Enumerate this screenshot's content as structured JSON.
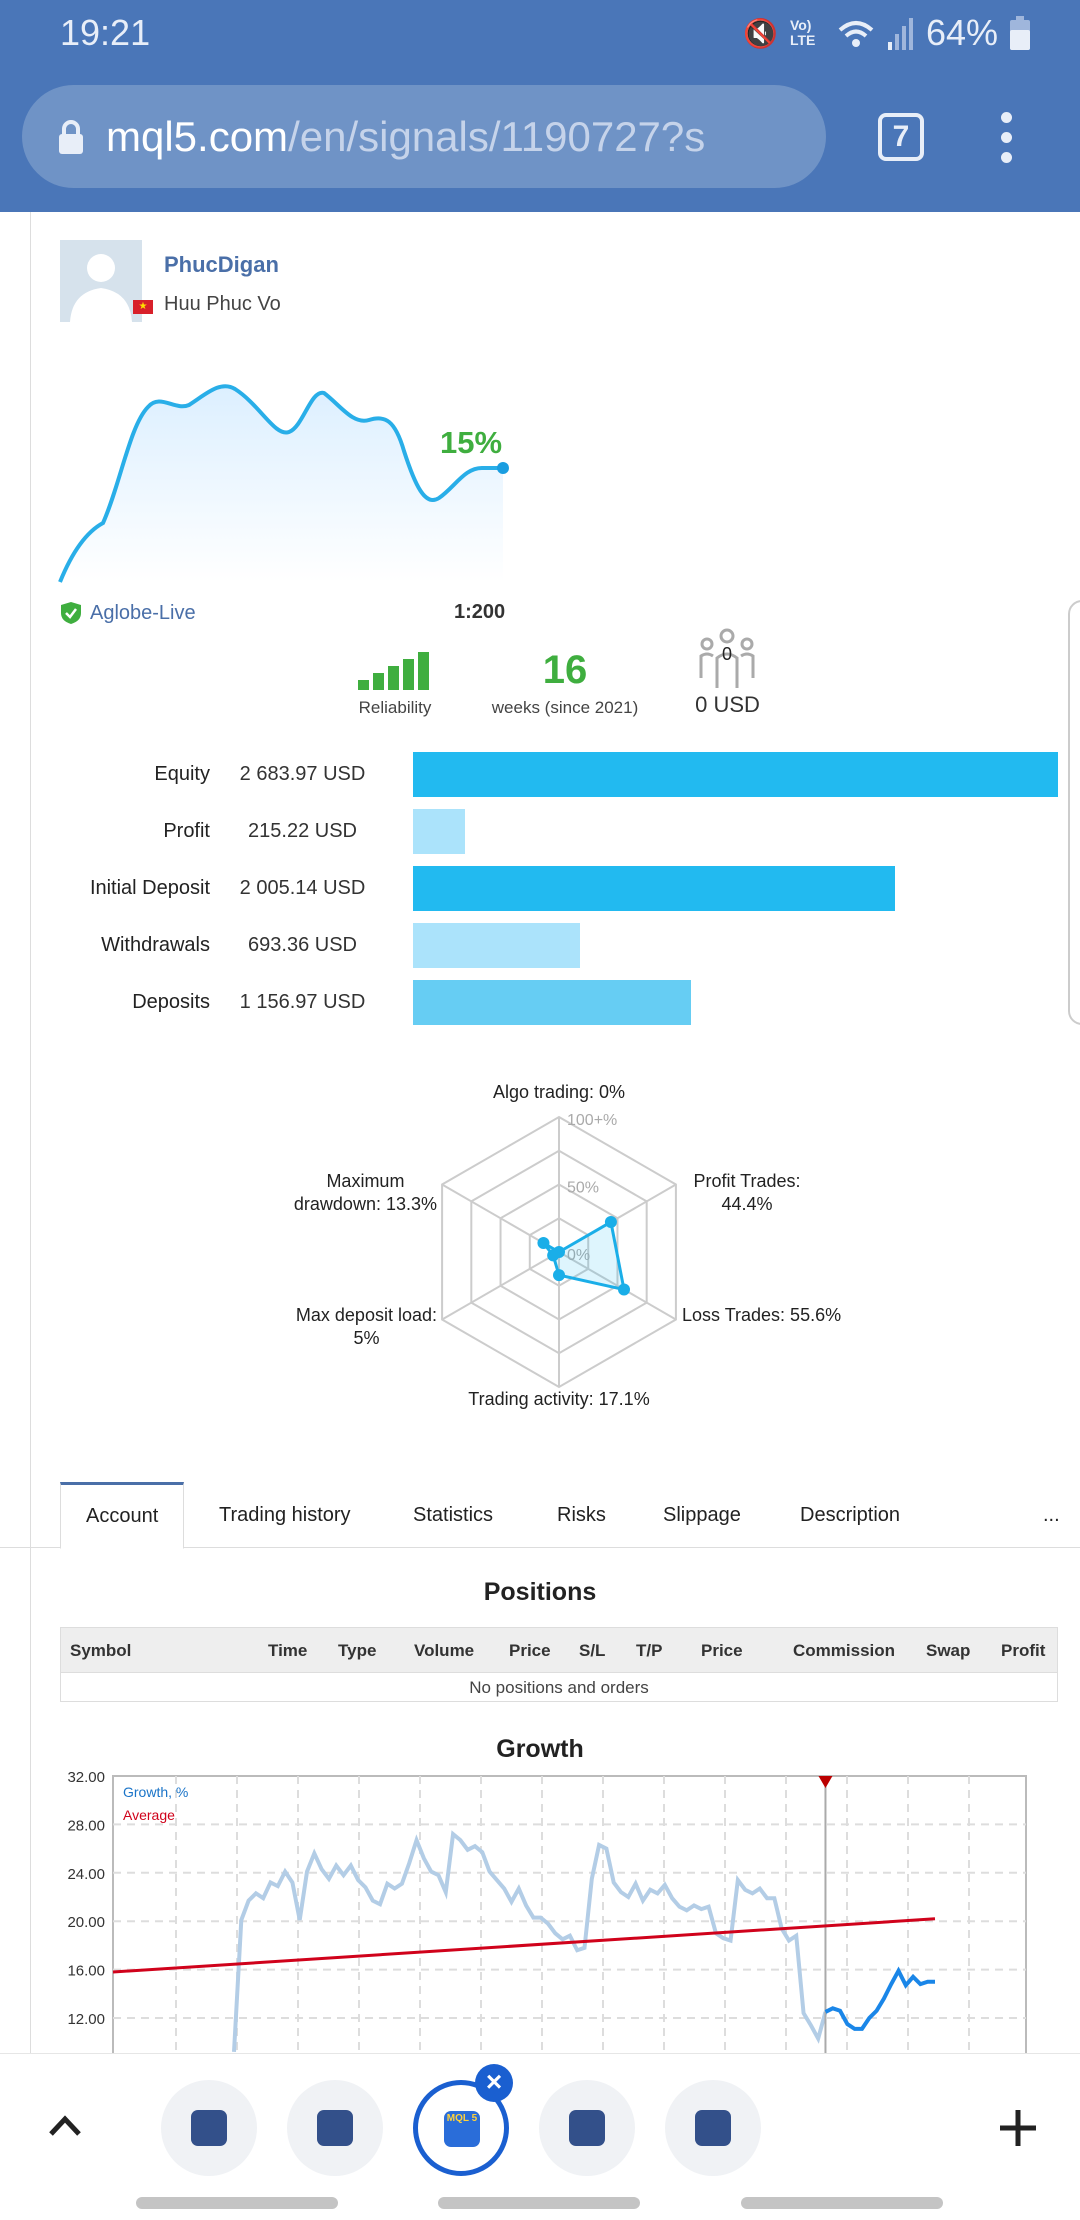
{
  "status_bar": {
    "time": "19:21",
    "network": "Vo) LTE",
    "battery": "64%",
    "icons": [
      "mute-icon",
      "volte-icon",
      "wifi-icon",
      "signal-icon",
      "battery-icon"
    ]
  },
  "browser": {
    "url_host": "mql5.com",
    "url_path": "/en/signals/1190727?s",
    "tab_count": "7"
  },
  "profile": {
    "username": "PhucDigan",
    "real_name": "Huu Phuc Vo",
    "country_flag": "vietnam-flag-icon"
  },
  "summary": {
    "gain": "15%",
    "broker": "Aglobe-Live",
    "leverage": "1:200",
    "reliability_label": "Reliability",
    "reliability_level": 5,
    "weeks": "16",
    "weeks_label": "weeks (since 2021)",
    "subscribers_count": "0",
    "subscribers_funds": "0 USD"
  },
  "balances": [
    {
      "label": "Equity",
      "value": "2 683.97 USD",
      "amount": 2683.97,
      "color": "#22baf0"
    },
    {
      "label": "Profit",
      "value": "215.22 USD",
      "amount": 215.22,
      "color": "#abe3fb"
    },
    {
      "label": "Initial Deposit",
      "value": "2 005.14 USD",
      "amount": 2005.14,
      "color": "#22baf0"
    },
    {
      "label": "Withdrawals",
      "value": "693.36 USD",
      "amount": 693.36,
      "color": "#abe3fb"
    },
    {
      "label": "Deposits",
      "value": "1 156.97 USD",
      "amount": 1156.97,
      "color": "#66cdf3"
    }
  ],
  "radar": {
    "scale_labels": [
      "100+%",
      "50%",
      "0%"
    ],
    "axes": [
      {
        "label": "Algo trading: 0%",
        "value": 0
      },
      {
        "label": "Profit Trades:",
        "label2": "44.4%",
        "value": 44.4
      },
      {
        "label": "Loss Trades: 55.6%",
        "value": 55.6
      },
      {
        "label": "Trading activity: 17.1%",
        "value": 17.1
      },
      {
        "label": "Max deposit load:",
        "label2": "5%",
        "value": 5
      },
      {
        "label": "Maximum",
        "label2": "drawdown: 13.3%",
        "value": 13.3
      }
    ]
  },
  "tabs": [
    {
      "label": "Account",
      "active": true
    },
    {
      "label": "Trading history"
    },
    {
      "label": "Statistics"
    },
    {
      "label": "Risks"
    },
    {
      "label": "Slippage"
    },
    {
      "label": "Description"
    },
    {
      "label": "..."
    }
  ],
  "positions": {
    "title": "Positions",
    "columns": [
      "Symbol",
      "Time",
      "Type",
      "Volume",
      "Price",
      "S/L",
      "T/P",
      "Price",
      "Commission",
      "Swap",
      "Profit"
    ],
    "empty_text": "No positions and orders"
  },
  "chart_data": {
    "type": "line",
    "title": "Growth",
    "y_ticks": [
      "32.00",
      "28.00",
      "24.00",
      "20.00",
      "16.00",
      "12.00"
    ],
    "ylim": [
      12,
      32
    ],
    "grid": true,
    "legend_placement": "top-left",
    "series": [
      {
        "name": "Growth, %",
        "color": "#b3cde6",
        "highlight_color": "#1a86e8",
        "values": [
          9.2,
          20.1,
          21.7,
          22.3,
          21.9,
          23.2,
          22.9,
          24.1,
          23.2,
          20.1,
          24.1,
          25.6,
          24.3,
          23.5,
          24.6,
          23.8,
          24.6,
          23.4,
          22.8,
          21.7,
          21.4,
          23.1,
          22.7,
          23.1,
          24.8,
          26.7,
          25.2,
          24.1,
          23.8,
          22.4,
          27.2,
          26.7,
          25.9,
          26.2,
          25.7,
          24.1,
          23.4,
          22.7,
          21.6,
          22.7,
          21.3,
          20.3,
          20.3,
          19.8,
          19.0,
          18.5,
          18.8,
          17.6,
          17.8,
          23.5,
          26.3,
          26.0,
          23.2,
          22.4,
          22.0,
          23.1,
          21.7,
          22.6,
          22.3,
          23.0,
          21.9,
          21.2,
          20.9,
          21.3,
          21.0,
          21.2,
          19.0,
          18.6,
          18.4,
          23.4,
          22.6,
          22.3,
          22.7,
          21.9,
          21.9,
          19.4,
          18.4,
          18.8,
          12.4,
          11.4,
          10.3,
          12.5,
          12.8,
          12.6,
          11.5,
          11.1,
          11.1,
          12.0,
          12.6,
          13.6,
          14.8,
          15.9,
          14.7,
          15.4,
          14.8,
          15.0,
          15.0
        ],
        "highlight_from_index": 81
      },
      {
        "name": "Average",
        "color": "#d0021b",
        "start": 15.8,
        "end": 20.2
      }
    ]
  },
  "bottom_tabs": {
    "count": 5,
    "active_index": 2,
    "active_favicon": "MQL 5",
    "buttons": [
      "chevron-up-icon",
      "close-tab-icon",
      "new-tab-plus-icon"
    ]
  }
}
